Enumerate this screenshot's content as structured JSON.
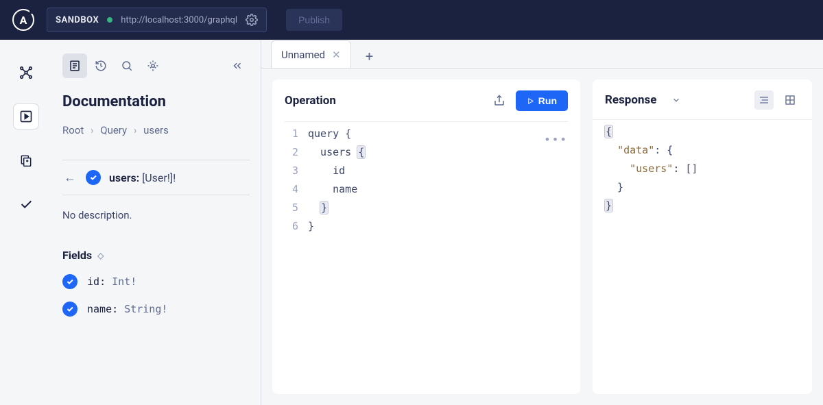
{
  "header": {
    "sandbox_label": "SANDBOX",
    "url": "http://localhost:3000/graphql",
    "publish_label": "Publish"
  },
  "tabs": {
    "active_label": "Unnamed"
  },
  "doc": {
    "title": "Documentation",
    "breadcrumbs": [
      "Root",
      "Query",
      "users"
    ],
    "detail": {
      "name": "users",
      "return_type": "[User!]!"
    },
    "description": "No description.",
    "fields_heading": "Fields",
    "fields": [
      {
        "name": "id",
        "type": "Int!"
      },
      {
        "name": "name",
        "type": "String!"
      }
    ]
  },
  "operation": {
    "title": "Operation",
    "run_label": "Run",
    "lines": [
      {
        "n": "1",
        "text": "query {"
      },
      {
        "n": "2",
        "text": "  users {",
        "hi_last": true
      },
      {
        "n": "3",
        "text": "    id"
      },
      {
        "n": "4",
        "text": "    name"
      },
      {
        "n": "5",
        "text": "  }",
        "hi_last": true
      },
      {
        "n": "6",
        "text": "}"
      }
    ]
  },
  "response": {
    "title": "Response",
    "lines": [
      "{",
      "  \"data\": {",
      "    \"users\": []",
      "  }",
      "}"
    ]
  }
}
